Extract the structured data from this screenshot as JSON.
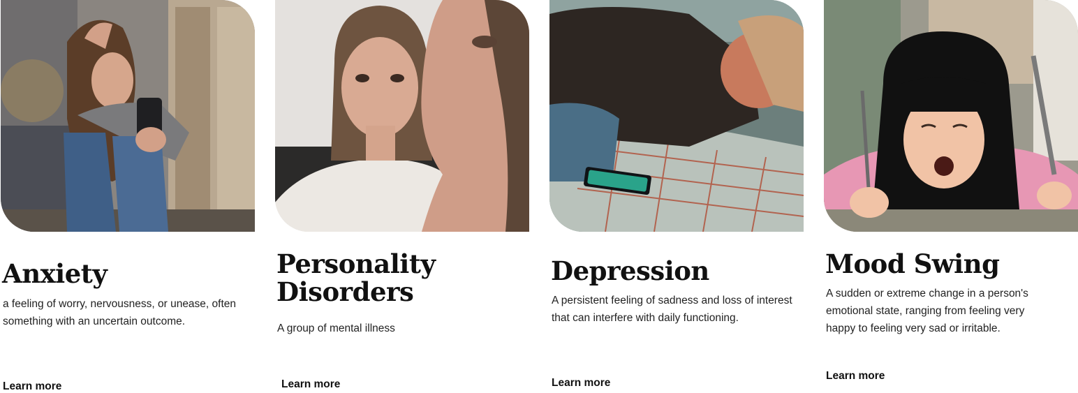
{
  "cards": [
    {
      "title": "Anxiety",
      "description": "a feeling of worry, nervousness, or unease, often something with an uncertain outcome.",
      "link": "Learn more"
    },
    {
      "title": "Personality Disorders",
      "description": "A group of mental illness",
      "link": "Learn more"
    },
    {
      "title": "Depression",
      "description": "A persistent feeling of sadness and loss of interest that can interfere with daily functioning.",
      "link": "Learn more"
    },
    {
      "title": "Mood Swing",
      "description": "A sudden or extreme change in a person's emotional state, ranging from feeling very happy to feeling very sad or irritable.",
      "link": "Learn more"
    }
  ]
}
